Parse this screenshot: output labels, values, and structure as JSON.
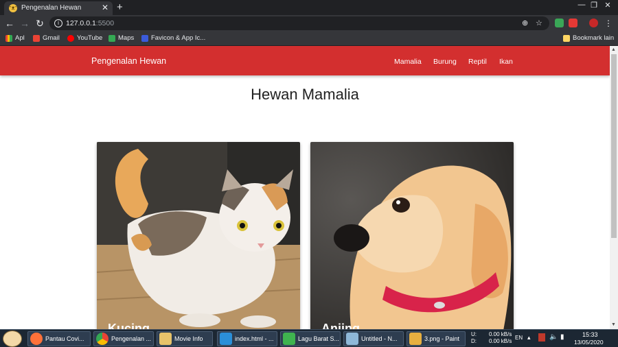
{
  "browser": {
    "tab": {
      "favicon": "cat-face-icon",
      "title": "Pengenalan Hewan",
      "close": "✕"
    },
    "new_tab": "+",
    "window": {
      "minimize": "—",
      "restore": "❐",
      "close": "✕"
    },
    "nav": {
      "back": "←",
      "forward": "→",
      "reload": "↻"
    },
    "address": {
      "host": "127.0.0.1",
      "port": ":5500"
    },
    "bookmarks": [
      {
        "label": "Apl",
        "color": "#e94235"
      },
      {
        "label": "Gmail",
        "color": "#ea4335"
      },
      {
        "label": "YouTube",
        "color": "#ff0000"
      },
      {
        "label": "Maps",
        "color": "#34a853"
      },
      {
        "label": "Favicon & App Ic...",
        "color": "#3b5bdb"
      }
    ],
    "other_bookmarks": "Bookmark lain"
  },
  "page": {
    "brand": "Pengenalan Hewan",
    "nav_links": [
      "Mamalia",
      "Burung",
      "Reptil",
      "Ikan"
    ],
    "heading": "Hewan Mamalia",
    "cards": [
      {
        "caption": "Kucing",
        "image": "calico-cat-photo"
      },
      {
        "caption": "Anjing",
        "image": "golden-puppy-photo"
      }
    ]
  },
  "taskbar": {
    "items": [
      {
        "label": "Pantau Covi...",
        "icon_color": "#ff7139"
      },
      {
        "label": "Pengenalan ...",
        "icon_color": "#4285f4"
      },
      {
        "label": "Movie Info",
        "icon_color": "#e8c36a"
      },
      {
        "label": "index.html - ...",
        "icon_color": "#2b8fd8"
      },
      {
        "label": "Lagu Barat S...",
        "icon_color": "#3fb34f"
      },
      {
        "label": "Untitled - N...",
        "icon_color": "#8fb8d8"
      },
      {
        "label": "3.png - Paint",
        "icon_color": "#e8b040"
      }
    ],
    "net": {
      "up_label": "U:",
      "down_label": "D:",
      "up": "0.00 kB/s",
      "down": "0.00 kB/s"
    },
    "lang": "EN",
    "time": "15:33",
    "date": "13/05/2020"
  }
}
